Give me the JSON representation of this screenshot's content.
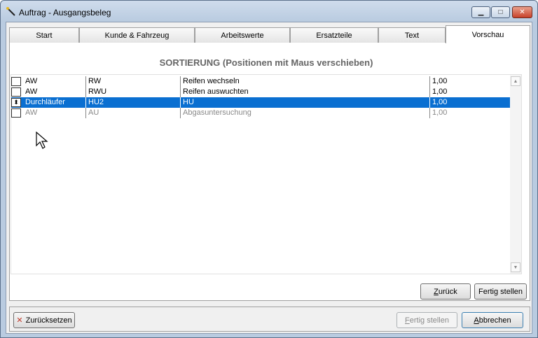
{
  "window": {
    "title": "Auftrag - Ausgangsbeleg",
    "minimize_glyph": "▁",
    "maximize_glyph": "□",
    "close_glyph": "✕"
  },
  "tabs": [
    {
      "label": "Start"
    },
    {
      "label": "Kunde & Fahrzeug"
    },
    {
      "label": "Arbeitswerte"
    },
    {
      "label": "Ersatzteile"
    },
    {
      "label": "Text"
    },
    {
      "label": "Vorschau",
      "active": true
    }
  ],
  "sort_header": "SORTIERUNG (Positionen mit Maus verschieben)",
  "rows": [
    {
      "type": "AW",
      "code": "RW",
      "description": "Reifen wechseln",
      "qty": "1,00"
    },
    {
      "type": "AW",
      "code": "RWU",
      "description": "Reifen auswuchten",
      "qty": "1,00"
    },
    {
      "type": "Durchläufer",
      "code": "HU2",
      "description": "HU",
      "qty": "1,00",
      "selected": true,
      "handle": "⬍"
    },
    {
      "type": "AW",
      "code": "AU",
      "description": "Abgasuntersuchung",
      "qty": "1,00"
    }
  ],
  "scroll": {
    "up": "▲",
    "down": "▼"
  },
  "panel_buttons": {
    "back_u": "Z",
    "back_rest": "urück",
    "finish": "Fertig stellen"
  },
  "footer_buttons": {
    "reset_icon": "✕",
    "reset_label": "Zurücksetzen",
    "finish_u": "F",
    "finish_rest": "ertig stellen",
    "cancel_u": "A",
    "cancel_rest": "bbrechen"
  },
  "colors": {
    "selection": "#0a6fd1",
    "reset_icon": "#c0392b"
  }
}
